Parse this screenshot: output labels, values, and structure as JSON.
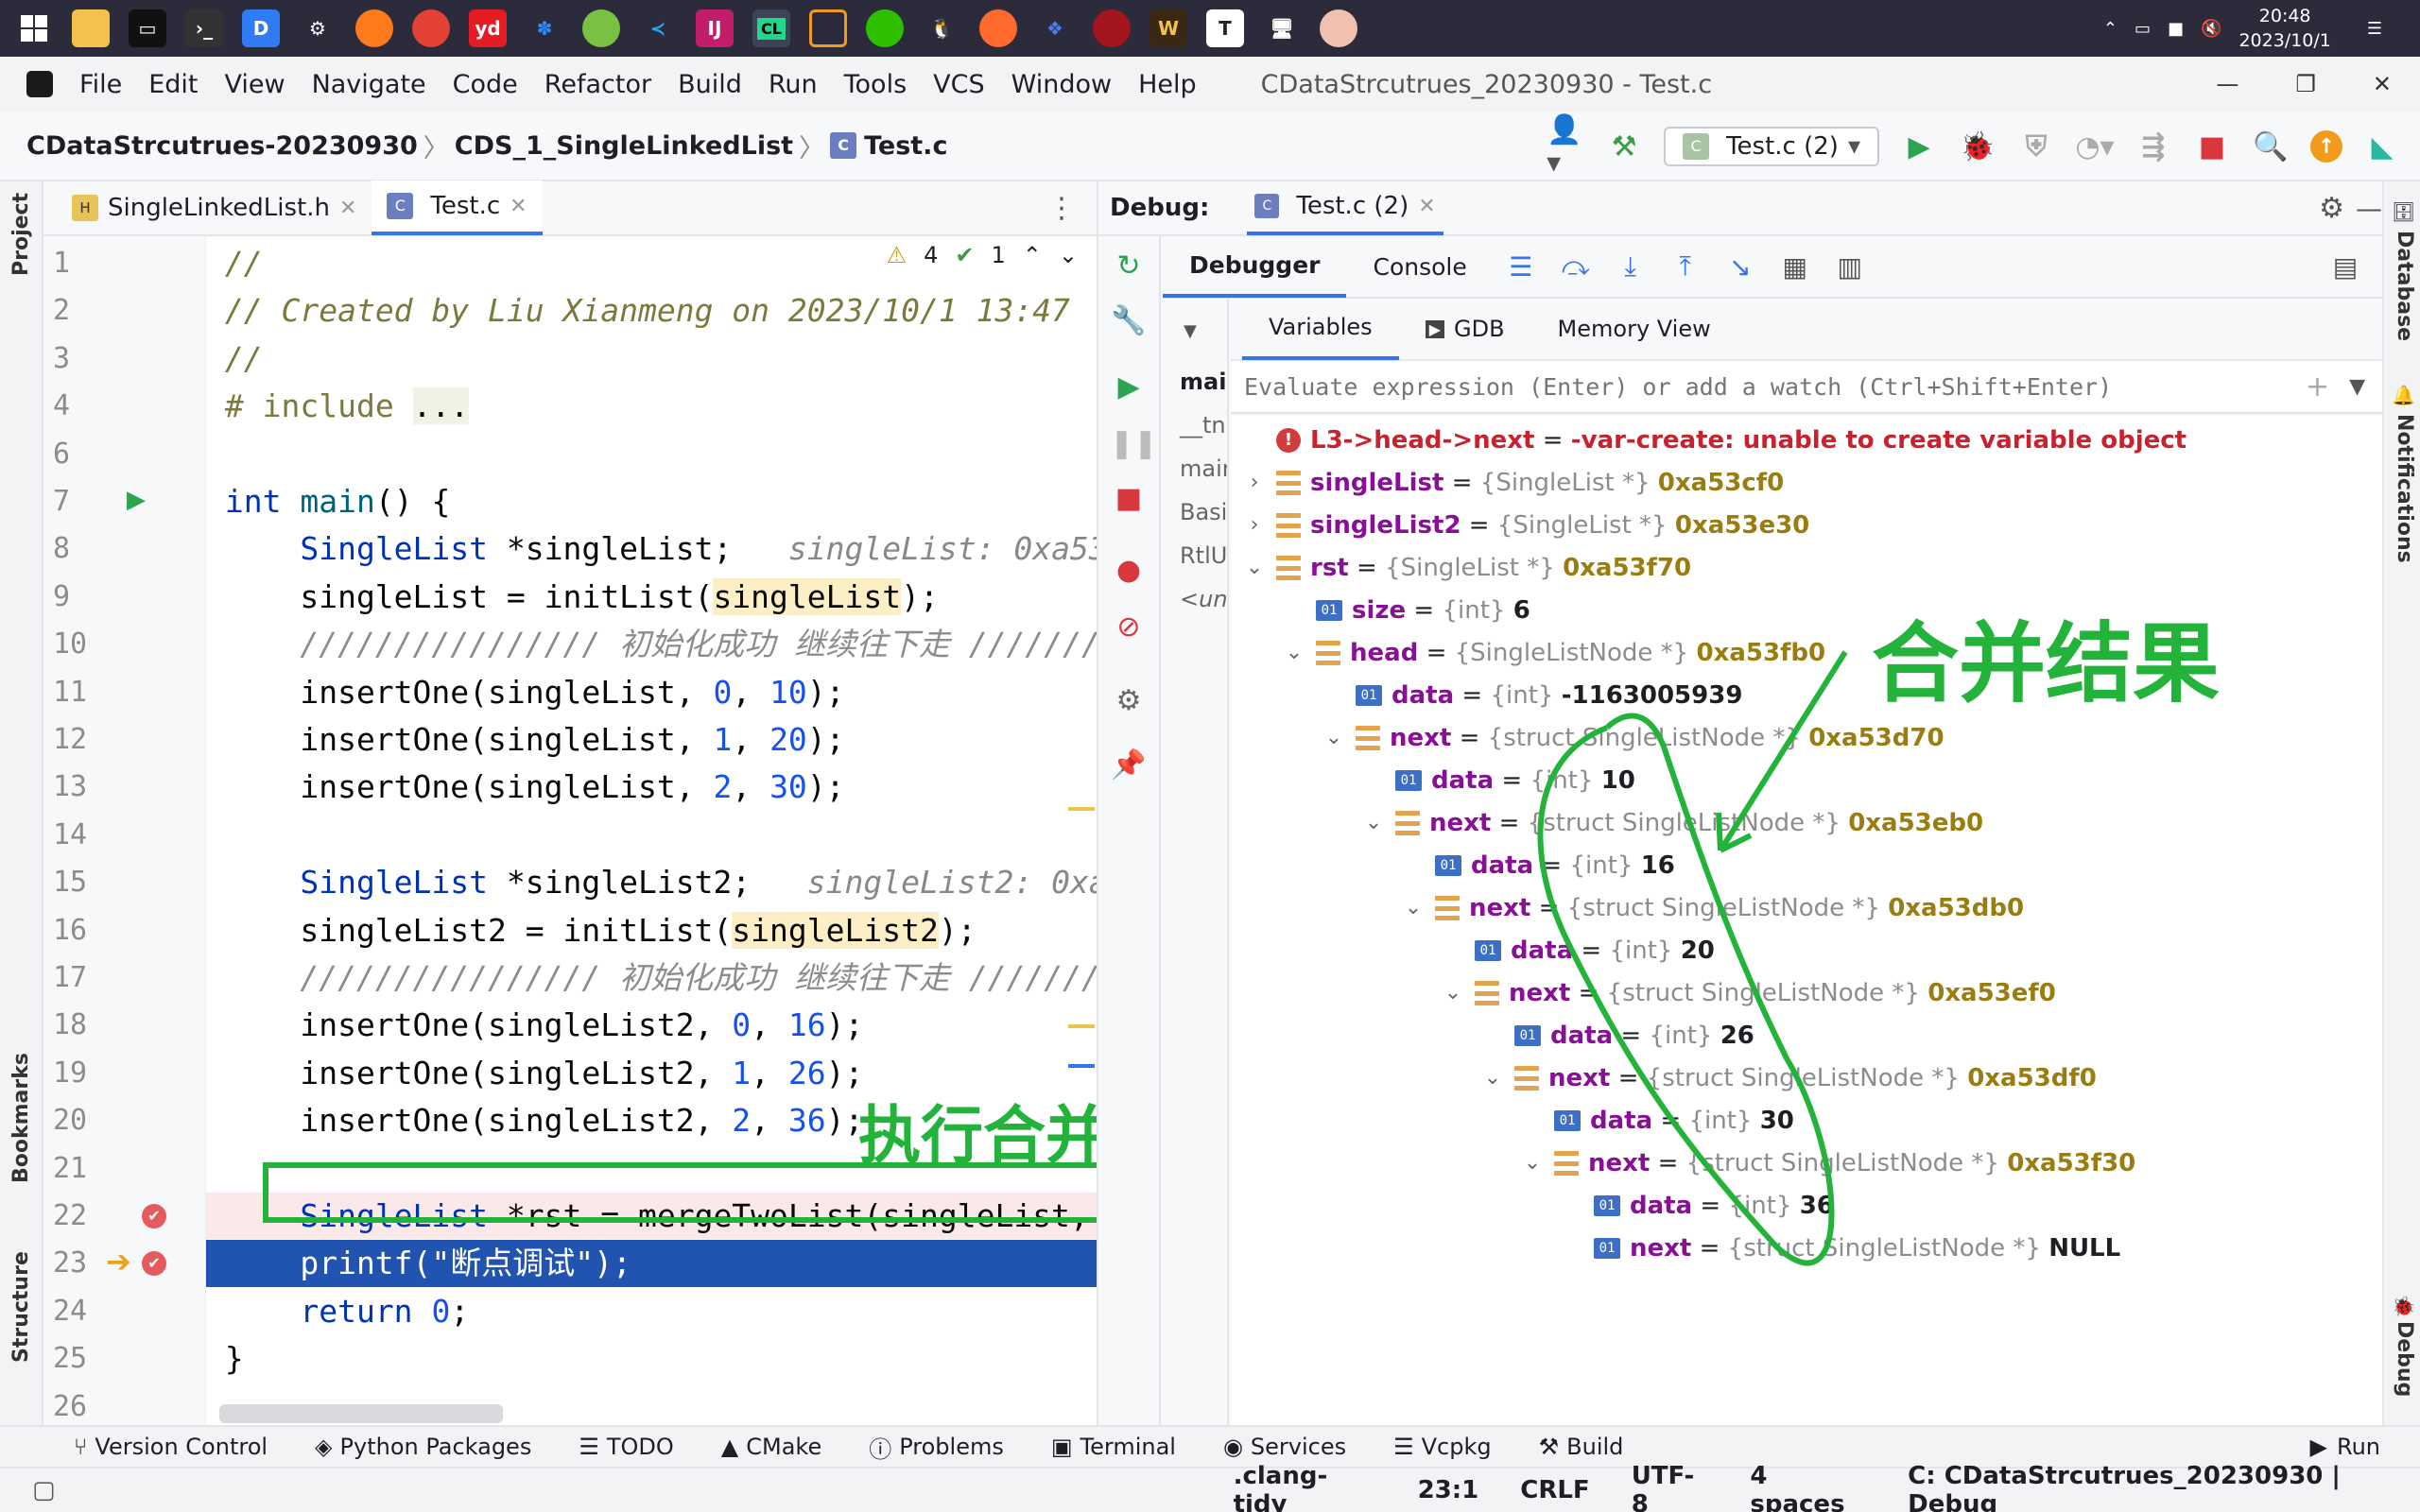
{
  "taskbar": {
    "time": "20:48",
    "date": "2023/10/1"
  },
  "menubar": {
    "items": [
      "File",
      "Edit",
      "View",
      "Navigate",
      "Code",
      "Refactor",
      "Build",
      "Run",
      "Tools",
      "VCS",
      "Window",
      "Help"
    ],
    "window_title": "CDataStrcutrues_20230930 - Test.c"
  },
  "navbar": {
    "project": "CDataStrcutrues-20230930",
    "folder": "CDS_1_SingleLinkedList",
    "file": "Test.c",
    "run_config": "Test.c (2)"
  },
  "left_strip": {
    "project": "Project",
    "bookmarks": "Bookmarks",
    "structure": "Structure"
  },
  "editor": {
    "tabs": [
      {
        "label": "SingleLinkedList.h"
      },
      {
        "label": "Test.c"
      }
    ],
    "inspections": {
      "warnings": "4",
      "ok": "1"
    },
    "line_numbers": [
      "1",
      "2",
      "3",
      "4",
      "6",
      "7",
      "8",
      "9",
      "10",
      "11",
      "12",
      "13",
      "14",
      "15",
      "16",
      "17",
      "18",
      "19",
      "20",
      "21",
      "22",
      "23",
      "24",
      "25",
      "26"
    ]
  },
  "annotations": {
    "merge_exec": "执行合并",
    "merge_result": "合并结果"
  },
  "debug": {
    "label": "Debug:",
    "session_tab": "Test.c (2)",
    "tabs": {
      "debugger": "Debugger",
      "console": "Console"
    },
    "var_tabs": {
      "variables": "Variables",
      "gdb": "GDB",
      "memory": "Memory View"
    },
    "eval_placeholder": "Evaluate expression (Enter) or add a watch (Ctrl+Shift+Enter)",
    "frames": [
      "mai",
      "__tn",
      "mair",
      "Basi",
      "RtlU",
      "<un"
    ],
    "variables": [
      {
        "name": "L3->head->next",
        "eq": " = ",
        "type": "",
        "value": "-var-create: unable to create variable object",
        "kind": "error"
      },
      {
        "name": "singleList",
        "eq": " = ",
        "type": "{SingleList *}",
        "value": "0xa53cf0",
        "kind": "ptr"
      },
      {
        "name": "singleList2",
        "eq": " = ",
        "type": "{SingleList *}",
        "value": "0xa53e30",
        "kind": "ptr"
      },
      {
        "name": "rst",
        "eq": " = ",
        "type": "{SingleList *}",
        "value": "0xa53f70",
        "kind": "ptr"
      },
      {
        "name": "size",
        "eq": " = ",
        "type": "{int}",
        "value": "6",
        "kind": "int"
      },
      {
        "name": "head",
        "eq": " = ",
        "type": "{SingleListNode *}",
        "value": "0xa53fb0",
        "kind": "ptr"
      },
      {
        "name": "data",
        "eq": " = ",
        "type": "{int}",
        "value": "-1163005939",
        "kind": "int"
      },
      {
        "name": "next",
        "eq": " = ",
        "type": "{struct SingleListNode *}",
        "value": "0xa53d70",
        "kind": "ptr"
      },
      {
        "name": "data",
        "eq": " = ",
        "type": "{int}",
        "value": "10",
        "kind": "int"
      },
      {
        "name": "next",
        "eq": " = ",
        "type": "{struct SingleListNode *}",
        "value": "0xa53eb0",
        "kind": "ptr"
      },
      {
        "name": "data",
        "eq": " = ",
        "type": "{int}",
        "value": "16",
        "kind": "int"
      },
      {
        "name": "next",
        "eq": " = ",
        "type": "{struct SingleListNode *}",
        "value": "0xa53db0",
        "kind": "ptr"
      },
      {
        "name": "data",
        "eq": " = ",
        "type": "{int}",
        "value": "20",
        "kind": "int"
      },
      {
        "name": "next",
        "eq": " = ",
        "type": "{struct SingleListNode *}",
        "value": "0xa53ef0",
        "kind": "ptr"
      },
      {
        "name": "data",
        "eq": " = ",
        "type": "{int}",
        "value": "26",
        "kind": "int"
      },
      {
        "name": "next",
        "eq": " = ",
        "type": "{struct SingleListNode *}",
        "value": "0xa53df0",
        "kind": "ptr"
      },
      {
        "name": "data",
        "eq": " = ",
        "type": "{int}",
        "value": "30",
        "kind": "int"
      },
      {
        "name": "next",
        "eq": " = ",
        "type": "{struct SingleListNode *}",
        "value": "0xa53f30",
        "kind": "ptr"
      },
      {
        "name": "data",
        "eq": " = ",
        "type": "{int}",
        "value": "36",
        "kind": "int"
      },
      {
        "name": "next",
        "eq": " = ",
        "type": "{struct SingleListNode *}",
        "value": "NULL",
        "kind": "int"
      }
    ]
  },
  "right_strip": {
    "database": "Database",
    "notifications": "Notifications",
    "debug": "Debug"
  },
  "bottom_tools": [
    "Version Control",
    "Python Packages",
    "TODO",
    "CMake",
    "Problems",
    "Terminal",
    "Services",
    "Vcpkg",
    "Build"
  ],
  "bottom_run": "Run",
  "status": {
    "tidy": ".clang-tidy",
    "position": "23:1",
    "line_sep": "CRLF",
    "encoding": "UTF-8",
    "indent": "4 spaces",
    "context": "C: CDataStrcutrues_20230930 | Debug"
  },
  "colors": {
    "accent": "#3574f0",
    "annotation_green": "#23b33a",
    "exec_line": "#2154b0"
  }
}
